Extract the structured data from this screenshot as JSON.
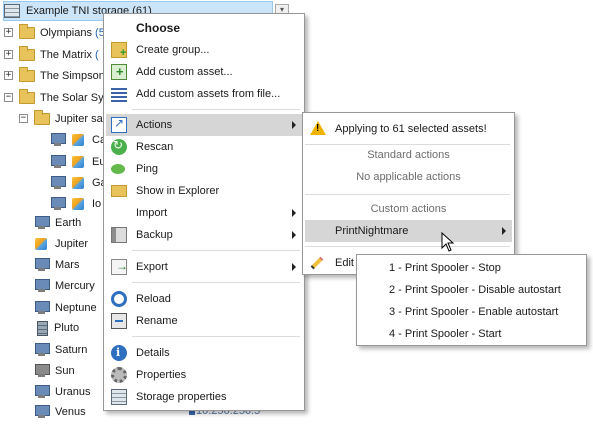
{
  "tree": {
    "root": {
      "label": "Example TNI storage (61)"
    },
    "folders": [
      {
        "label": "Olympians",
        "count": "(5"
      },
      {
        "label": "The Matrix",
        "count": "("
      },
      {
        "label": "The Simpsons",
        "count": ""
      },
      {
        "label": "The Solar Sys",
        "count": ""
      }
    ],
    "subfolder": {
      "label": "Jupiter sa"
    },
    "moons": [
      {
        "label": "Ca"
      },
      {
        "label": "Eu"
      },
      {
        "label": "Ga"
      },
      {
        "label": "Io"
      }
    ],
    "planets": [
      {
        "label": "Earth",
        "icon": "windows-pc-icon"
      },
      {
        "label": "Jupiter",
        "icon": "windows-logo-icon"
      },
      {
        "label": "Mars",
        "icon": "windows-pc-icon"
      },
      {
        "label": "Mercury",
        "icon": "windows-pc-icon"
      },
      {
        "label": "Neptune",
        "icon": "windows-pc-icon"
      },
      {
        "label": "Pluto",
        "icon": "network-device-icon"
      },
      {
        "label": "Saturn",
        "icon": "windows-pc-icon"
      },
      {
        "label": "Sun",
        "icon": "linux-pc-icon"
      },
      {
        "label": "Uranus",
        "icon": "windows-pc-icon"
      },
      {
        "label": "Venus",
        "icon": "windows-pc-icon"
      }
    ],
    "ip_fragment": "10.256.256.5"
  },
  "main_menu": {
    "heading": "Choose",
    "items": [
      {
        "label": "Create group...",
        "icon": "create-group-icon"
      },
      {
        "label": "Add custom asset...",
        "icon": "add-asset-icon"
      },
      {
        "label": "Add custom assets from file...",
        "icon": "asset-list-icon"
      },
      {
        "label": "Actions",
        "icon": "actions-icon",
        "submenu": true,
        "highlighted": true
      },
      {
        "label": "Rescan",
        "icon": "rescan-icon"
      },
      {
        "label": "Ping",
        "icon": "ping-icon"
      },
      {
        "label": "Show in Explorer",
        "icon": "folder-icon"
      },
      {
        "label": "Import",
        "icon": "",
        "submenu": true
      },
      {
        "label": "Backup",
        "icon": "backup-icon",
        "submenu": true
      },
      {
        "label": "Export",
        "icon": "export-icon",
        "submenu": true
      },
      {
        "label": "Reload",
        "icon": "reload-icon"
      },
      {
        "label": "Rename",
        "icon": "rename-icon"
      },
      {
        "label": "Details",
        "icon": "info-icon"
      },
      {
        "label": "Properties",
        "icon": "gear-icon"
      },
      {
        "label": "Storage properties",
        "icon": "storage-icon"
      }
    ]
  },
  "actions_menu": {
    "notice": "Applying to 61 selected assets!",
    "standard_header": "Standard actions",
    "standard_empty": "No applicable actions",
    "custom_header": "Custom actions",
    "custom_item": "PrintNightmare",
    "edit_item": "Edit"
  },
  "printnightmare_menu": {
    "items": [
      "1 - Print Spooler - Stop",
      "2 - Print Spooler - Disable autostart",
      "3 - Print Spooler - Enable autostart",
      "4 - Print Spooler - Start"
    ]
  }
}
